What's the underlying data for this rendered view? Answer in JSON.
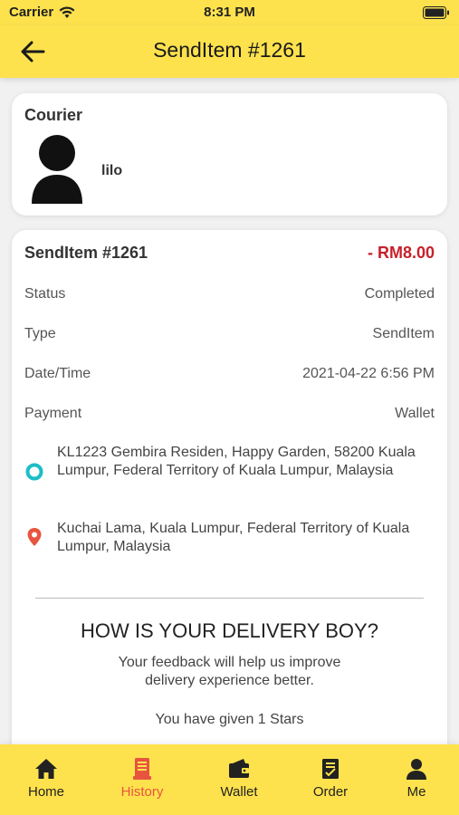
{
  "status_bar": {
    "carrier": "Carrier",
    "time": "8:31 PM"
  },
  "header": {
    "title": "SendItem #1261"
  },
  "courier": {
    "heading": "Courier",
    "name": "lilo"
  },
  "order": {
    "title": "SendItem #1261",
    "amount": "- RM8.00",
    "amount_color": "#c8202a",
    "rows": [
      {
        "label": "Status",
        "value": "Completed"
      },
      {
        "label": "Type",
        "value": "SendItem"
      },
      {
        "label": "Date/Time",
        "value": "2021-04-22 6:56 PM"
      },
      {
        "label": "Payment",
        "value": "Wallet"
      }
    ],
    "pickup": {
      "icon": "pickup-circle-icon",
      "address": "KL1223 Gembira Residen, Happy Garden, 58200 Kuala Lumpur, Federal Territory of Kuala Lumpur, Malaysia"
    },
    "dropoff": {
      "icon": "location-pin-icon",
      "address": "Kuchai Lama, Kuala Lumpur, Federal Territory of Kuala Lumpur, Malaysia"
    }
  },
  "feedback": {
    "title": "HOW IS YOUR DELIVERY BOY?",
    "line1": "Your feedback will help us improve",
    "line2": "delivery experience better.",
    "given": "You have given  1 Stars"
  },
  "tabs": [
    {
      "label": "Home",
      "icon": "home-icon"
    },
    {
      "label": "History",
      "icon": "history-icon",
      "active": true
    },
    {
      "label": "Wallet",
      "icon": "wallet-icon"
    },
    {
      "label": "Order",
      "icon": "order-icon"
    },
    {
      "label": "Me",
      "icon": "person-icon"
    }
  ],
  "colors": {
    "accent": "#fde24d",
    "active_tab": "#e8553f",
    "pickup": "#1bbdc7",
    "dropoff": "#e8553f"
  }
}
